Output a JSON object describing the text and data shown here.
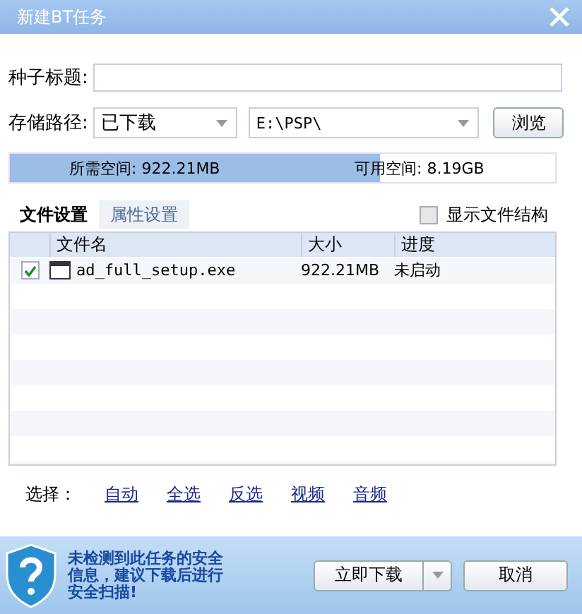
{
  "window": {
    "title": "新建BT任务"
  },
  "title_field": {
    "label": "种子标题:"
  },
  "path": {
    "label": "存储路径:",
    "category": "已下载",
    "folder": "E:\\PSP\\",
    "browse": "浏览"
  },
  "space": {
    "required": "所需空间: 922.21MB",
    "available": "可用空间: 8.19GB",
    "level": 0.68
  },
  "tabs": [
    {
      "label": "文件设置",
      "selected": true
    },
    {
      "label": "属性设置",
      "selected": false
    }
  ],
  "show_structure": {
    "label": "显示文件结构",
    "checked": false
  },
  "table": {
    "columns": [
      "文件名",
      "大小",
      "进度"
    ],
    "rows": [
      {
        "checked": true,
        "name": "ad_full_setup.exe",
        "size": "922.21MB",
        "progress": "未启动"
      }
    ]
  },
  "select": {
    "label": "选择：",
    "links": [
      "自动",
      "全选",
      "反选",
      "视频",
      "音频"
    ]
  },
  "footer": {
    "warning": "未检测到此任务的安全信息，建议下载后进行安全扫描!",
    "download": "立即下载",
    "cancel": "取消"
  }
}
